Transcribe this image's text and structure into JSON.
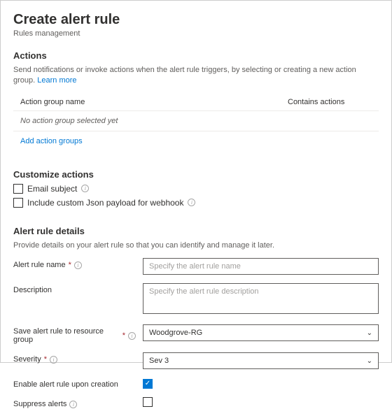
{
  "header": {
    "title": "Create alert rule",
    "subtitle": "Rules management"
  },
  "actions": {
    "title": "Actions",
    "description": "Send notifications or invoke actions when the alert rule triggers, by selecting or creating a new action group. ",
    "learn_more": "Learn more",
    "col_name": "Action group name",
    "col_contains": "Contains actions",
    "empty_text": "No action group selected yet",
    "add_link": "Add action groups"
  },
  "customize": {
    "title": "Customize actions",
    "email_subject": "Email subject",
    "json_payload": "Include custom Json payload for webhook"
  },
  "details": {
    "title": "Alert rule details",
    "description": "Provide details on your alert rule so that you can identify and manage it later.",
    "name_label": "Alert rule name",
    "name_placeholder": "Specify the alert rule name",
    "desc_label": "Description",
    "desc_placeholder": "Specify the alert rule description",
    "rg_label": "Save alert rule to resource group",
    "rg_value": "Woodgrove-RG",
    "severity_label": "Severity",
    "severity_value": "Sev 3",
    "enable_label": "Enable alert rule upon creation",
    "suppress_label": "Suppress alerts"
  }
}
